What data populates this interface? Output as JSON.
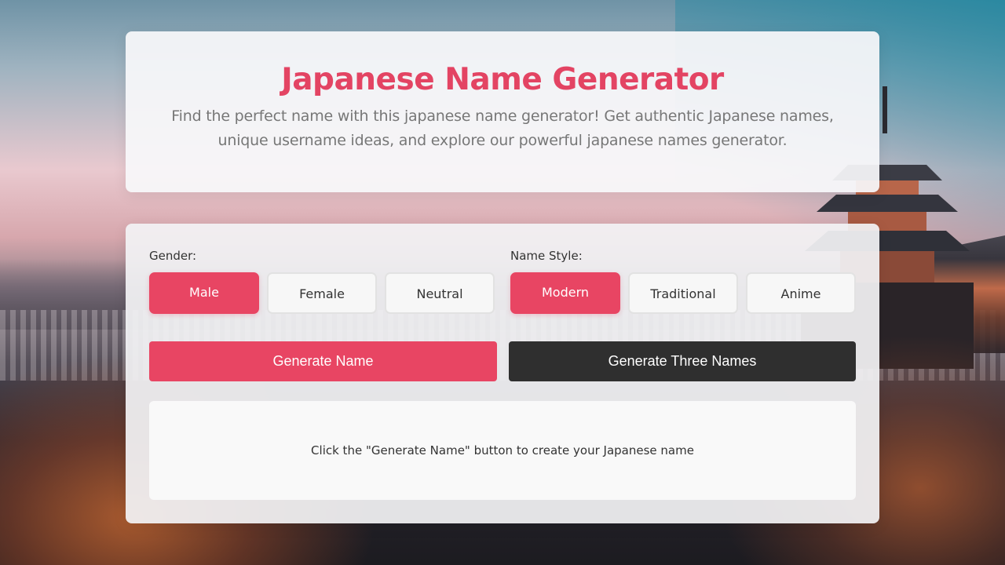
{
  "header": {
    "title": "Japanese Name Generator",
    "subtitle": "Find the perfect name with this japanese name generator! Get authentic Japanese names, unique username ideas, and explore our powerful japanese names generator."
  },
  "gender": {
    "label": "Gender:",
    "options": [
      "Male",
      "Female",
      "Neutral"
    ],
    "selected": "Male"
  },
  "style": {
    "label": "Name Style:",
    "options": [
      "Modern",
      "Traditional",
      "Anime"
    ],
    "selected": "Modern"
  },
  "actions": {
    "generate_label": "Generate Name",
    "generate_three_label": "Generate Three Names"
  },
  "result": {
    "placeholder": "Click the \"Generate Name\" button to create your Japanese name"
  },
  "colors": {
    "accent": "#e84563",
    "title": "#e34463",
    "dark_button": "#2f2f2f"
  }
}
